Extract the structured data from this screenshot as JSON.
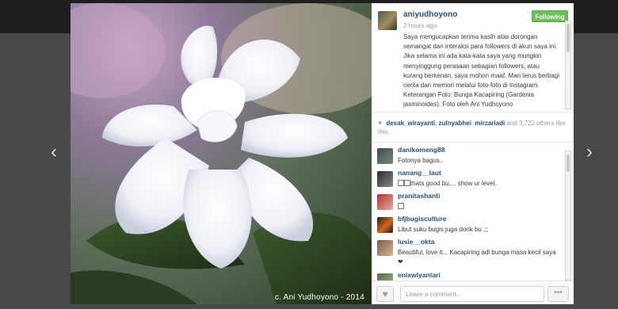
{
  "post": {
    "username": "aniyudhoyono",
    "time_ago": "2 hours ago",
    "follow_label": "Following",
    "caption": "Saya mengucapkan terima kasih atas dorongan semangat dan interaksi para followers di akun saya ini. Jika selama ini ada kata-kata saya yang mungkin menyinggung perasaan sebagian followers, atau kurang berkenan, saya mohon maaf. Mari terus berbagi cerita dan memori melalui foto-foto di Instagram. Keterangan Foto: Bunga Kacapiring (Gardenia jasminoides). Foto oleh Ani Yudhoyono",
    "photo_credit": "c. Ani Yudhoyono - 2014"
  },
  "likes": {
    "likers": [
      "desak_wirayanti",
      "zulnyabhei",
      "mirzariadi"
    ],
    "separator": ", ",
    "and_text": " and ",
    "others_count": "3,722",
    "suffix": " others like this."
  },
  "comments": [
    {
      "user": "danikomeng88",
      "text": "Fotonya bagus.."
    },
    {
      "user": "nanang__laut",
      "text": "thats good bu.... show ur level."
    },
    {
      "user": "pranitashanti",
      "text": ""
    },
    {
      "user": "bfjbugisculture",
      "text": "Libut suku bugis juga donk bu ;;;"
    },
    {
      "user": "lusie__okta",
      "text": "Beautiful, love it... Kacapiring adl bunga masa kecil saya ❤"
    },
    {
      "user": "enixwlyantari",
      "text": ""
    }
  ],
  "footer": {
    "comment_placeholder": "Leave a comment...",
    "more_label": "•••"
  },
  "icons": {
    "prev": "chevron-left-icon",
    "next": "chevron-right-icon",
    "like": "heart-icon"
  },
  "colors": {
    "follow_button": "#6bbf58",
    "username_link": "#2a4f76"
  }
}
